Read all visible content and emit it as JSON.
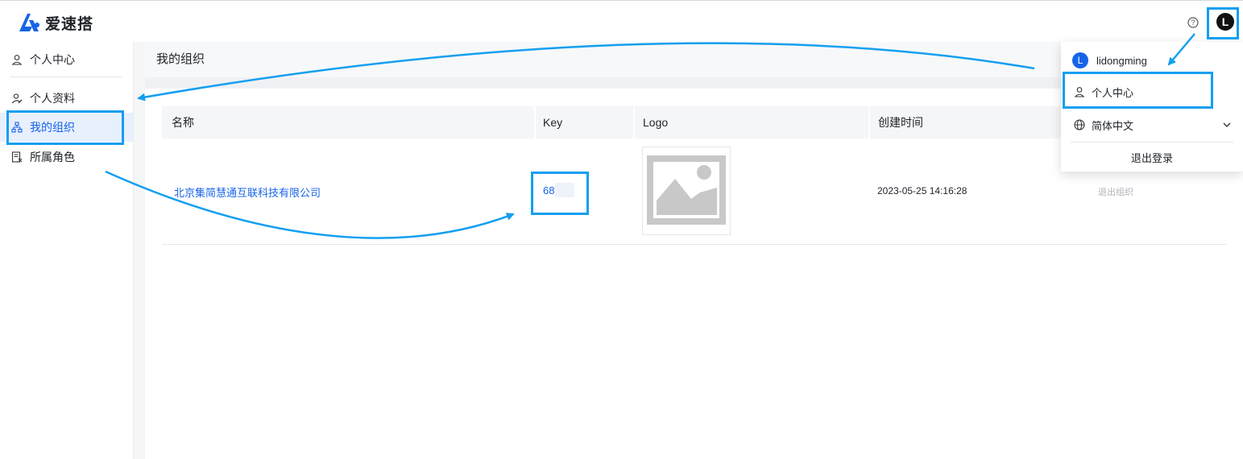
{
  "brand": {
    "name": "爱速搭",
    "color": "#1764e8"
  },
  "header": {
    "help_icon": "question-circle-icon",
    "avatar_letter": "L"
  },
  "sidebar": {
    "items": [
      {
        "label": "个人中心",
        "icon": "user-icon",
        "active": false
      },
      {
        "label": "个人资料",
        "icon": "user-edit-icon",
        "active": false
      },
      {
        "label": "我的组织",
        "icon": "org-tree-icon",
        "active": true
      },
      {
        "label": "所属角色",
        "icon": "role-doc-icon",
        "active": false
      }
    ]
  },
  "page": {
    "title": "我的组织",
    "table": {
      "columns": [
        "名称",
        "Key",
        "Logo",
        "创建时间"
      ],
      "rows": [
        {
          "name": "北京集简慧通互联科技有限公司",
          "key": "68t",
          "created": "2023-05-25 14:16:28",
          "action": "退出组织"
        }
      ]
    }
  },
  "dropdown": {
    "username": "lidongming",
    "avatar_letter": "L",
    "profile_label": "个人中心",
    "language_label": "简体中文",
    "logout_label": "退出登录"
  },
  "annotation_color": "#139ff0"
}
